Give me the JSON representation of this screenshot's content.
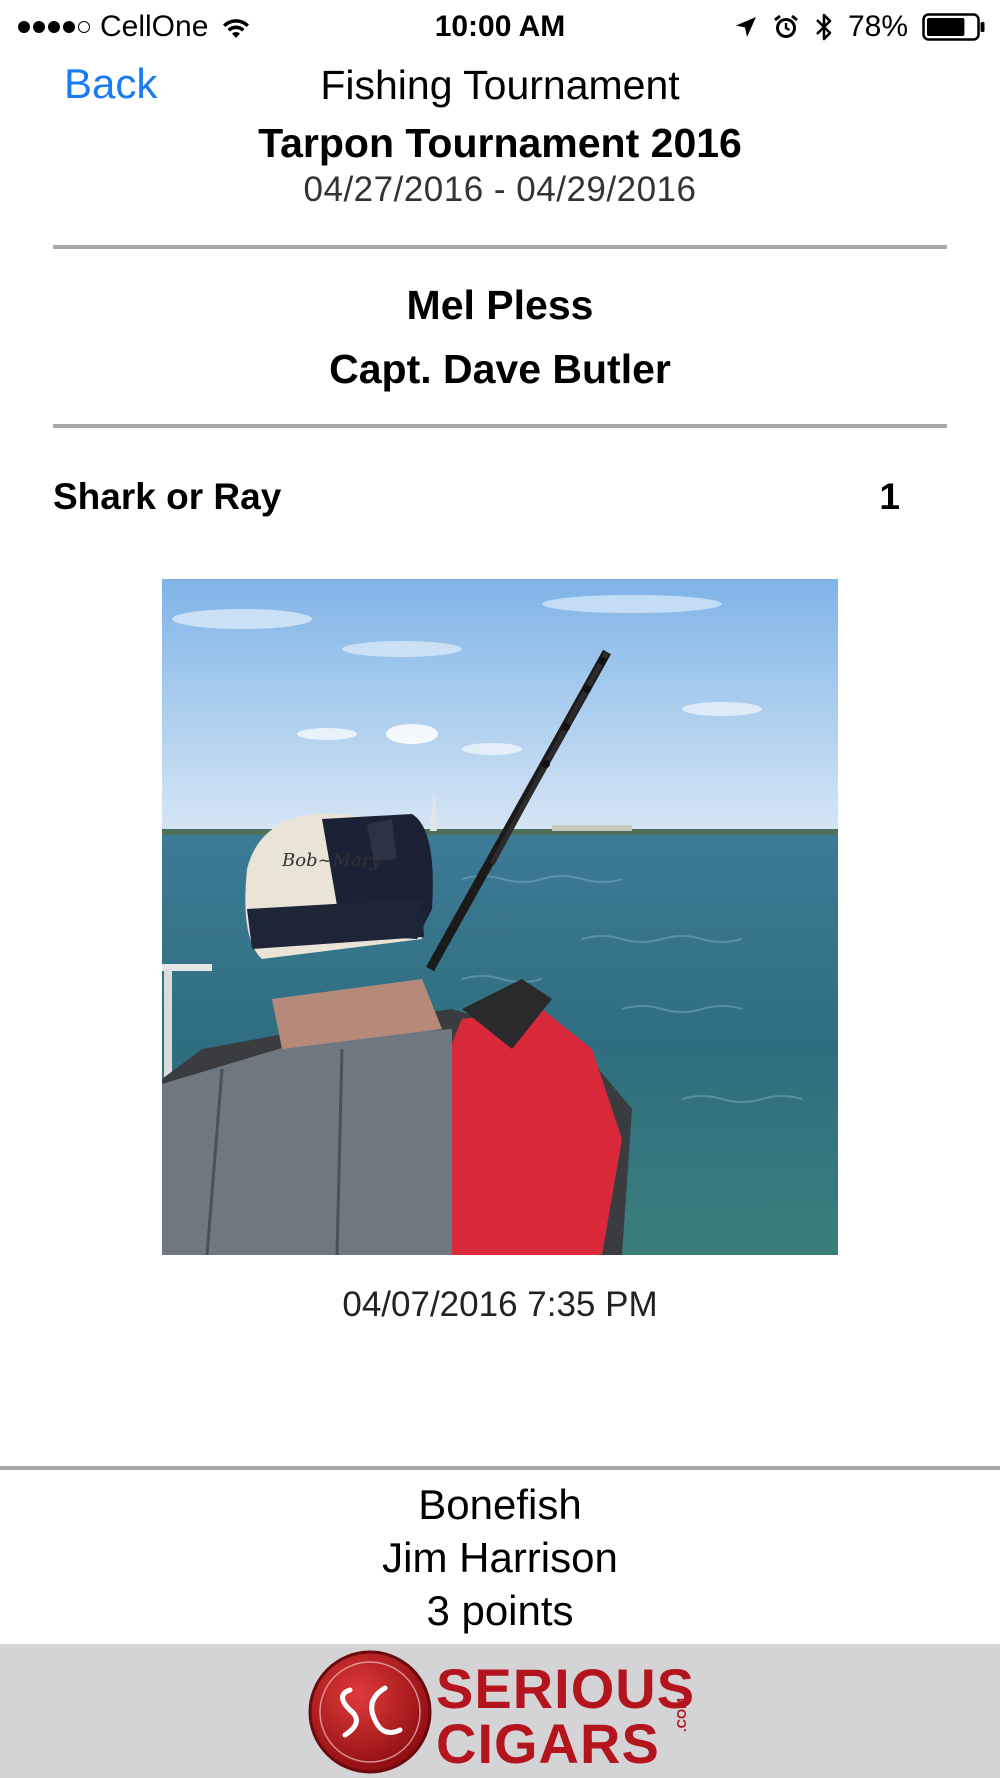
{
  "status_bar": {
    "carrier": "CellOne",
    "time": "10:00 AM",
    "battery_percent": "78%",
    "signal_bars_filled": 4,
    "signal_bars_total": 5,
    "battery_level": 0.78,
    "icons": [
      "wifi-icon",
      "location-arrow-icon",
      "alarm-icon",
      "bluetooth-icon",
      "battery-icon"
    ]
  },
  "nav": {
    "back_label": "Back",
    "title": "Fishing Tournament"
  },
  "tournament": {
    "name": "Tarpon Tournament 2016",
    "dates": "04/27/2016 - 04/29/2016"
  },
  "team": {
    "angler": "Mel Pless",
    "captain": "Capt. Dave Butler"
  },
  "catch": {
    "category": "Shark or Ray",
    "count": "1",
    "timestamp": "04/07/2016 7:35 PM"
  },
  "next_entry": {
    "species": "Bonefish",
    "angler": "Jim Harrison",
    "points": "3 points"
  },
  "ad": {
    "brand_line1": "SERIOUS",
    "brand_line2": "CIGARS",
    "brand_suffix": ".COM",
    "colors": {
      "brand_red": "#b3141d",
      "banner_bg": "#d4d4d6"
    }
  },
  "colors": {
    "link_blue": "#1a7cf5",
    "divider_gray": "#a9a9a9"
  }
}
